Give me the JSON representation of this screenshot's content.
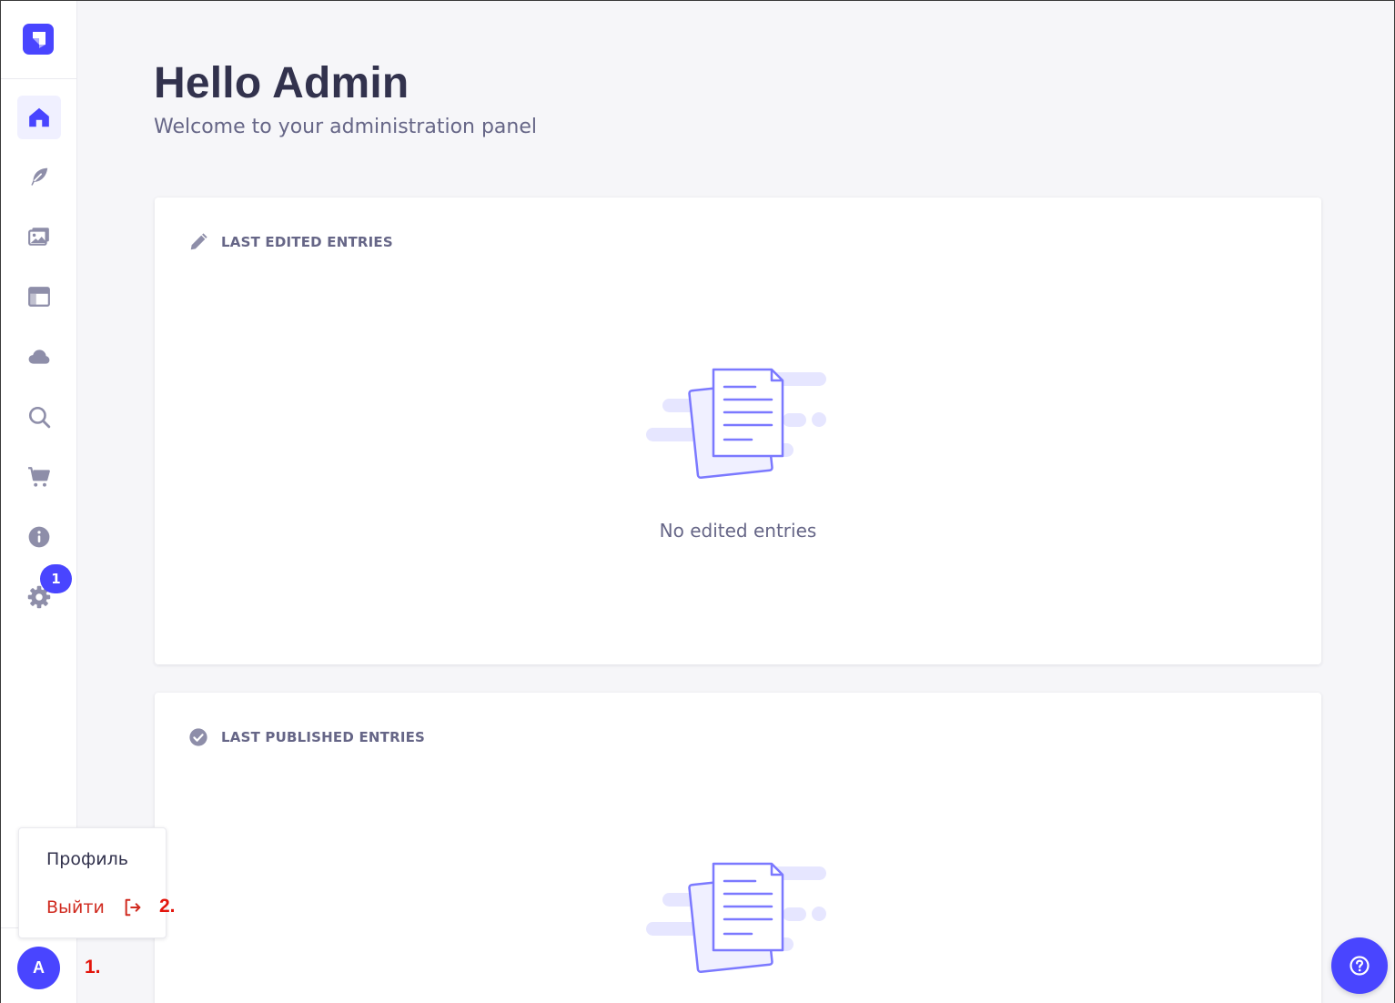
{
  "sidebar": {
    "logo_icon": "strapi-logo-icon",
    "items": [
      {
        "name": "home",
        "icon": "home-icon",
        "active": true
      },
      {
        "name": "content-manager",
        "icon": "feather-icon",
        "active": false
      },
      {
        "name": "media-library",
        "icon": "images-icon",
        "active": false
      },
      {
        "name": "content-type-builder",
        "icon": "layout-icon",
        "active": false
      },
      {
        "name": "cloud",
        "icon": "cloud-icon",
        "active": false
      },
      {
        "name": "search",
        "icon": "search-icon",
        "active": false
      },
      {
        "name": "marketplace",
        "icon": "cart-icon",
        "active": false
      },
      {
        "name": "info",
        "icon": "info-icon",
        "active": false
      },
      {
        "name": "settings",
        "icon": "gear-icon",
        "active": false
      }
    ],
    "settings_badge": "1",
    "avatar_initial": "A"
  },
  "user_menu": {
    "profile_label": "Профиль",
    "logout_label": "Выйти"
  },
  "annotations": {
    "step1": "1.",
    "step2": "2."
  },
  "main": {
    "title": "Hello Admin",
    "subtitle": "Welcome to your administration panel",
    "cards": [
      {
        "header": "LAST EDITED ENTRIES",
        "icon": "pencil-icon",
        "empty_text": "No edited entries"
      },
      {
        "header": "LAST PUBLISHED ENTRIES",
        "icon": "check-circle-icon",
        "empty_text": ""
      }
    ]
  },
  "help_button_icon": "question-circle-icon",
  "colors": {
    "primary": "#4945ff",
    "danger": "#d02b20",
    "annotation": "#e3150c",
    "icon_neutral": "#8e8ea9",
    "background": "#f6f6f9"
  }
}
